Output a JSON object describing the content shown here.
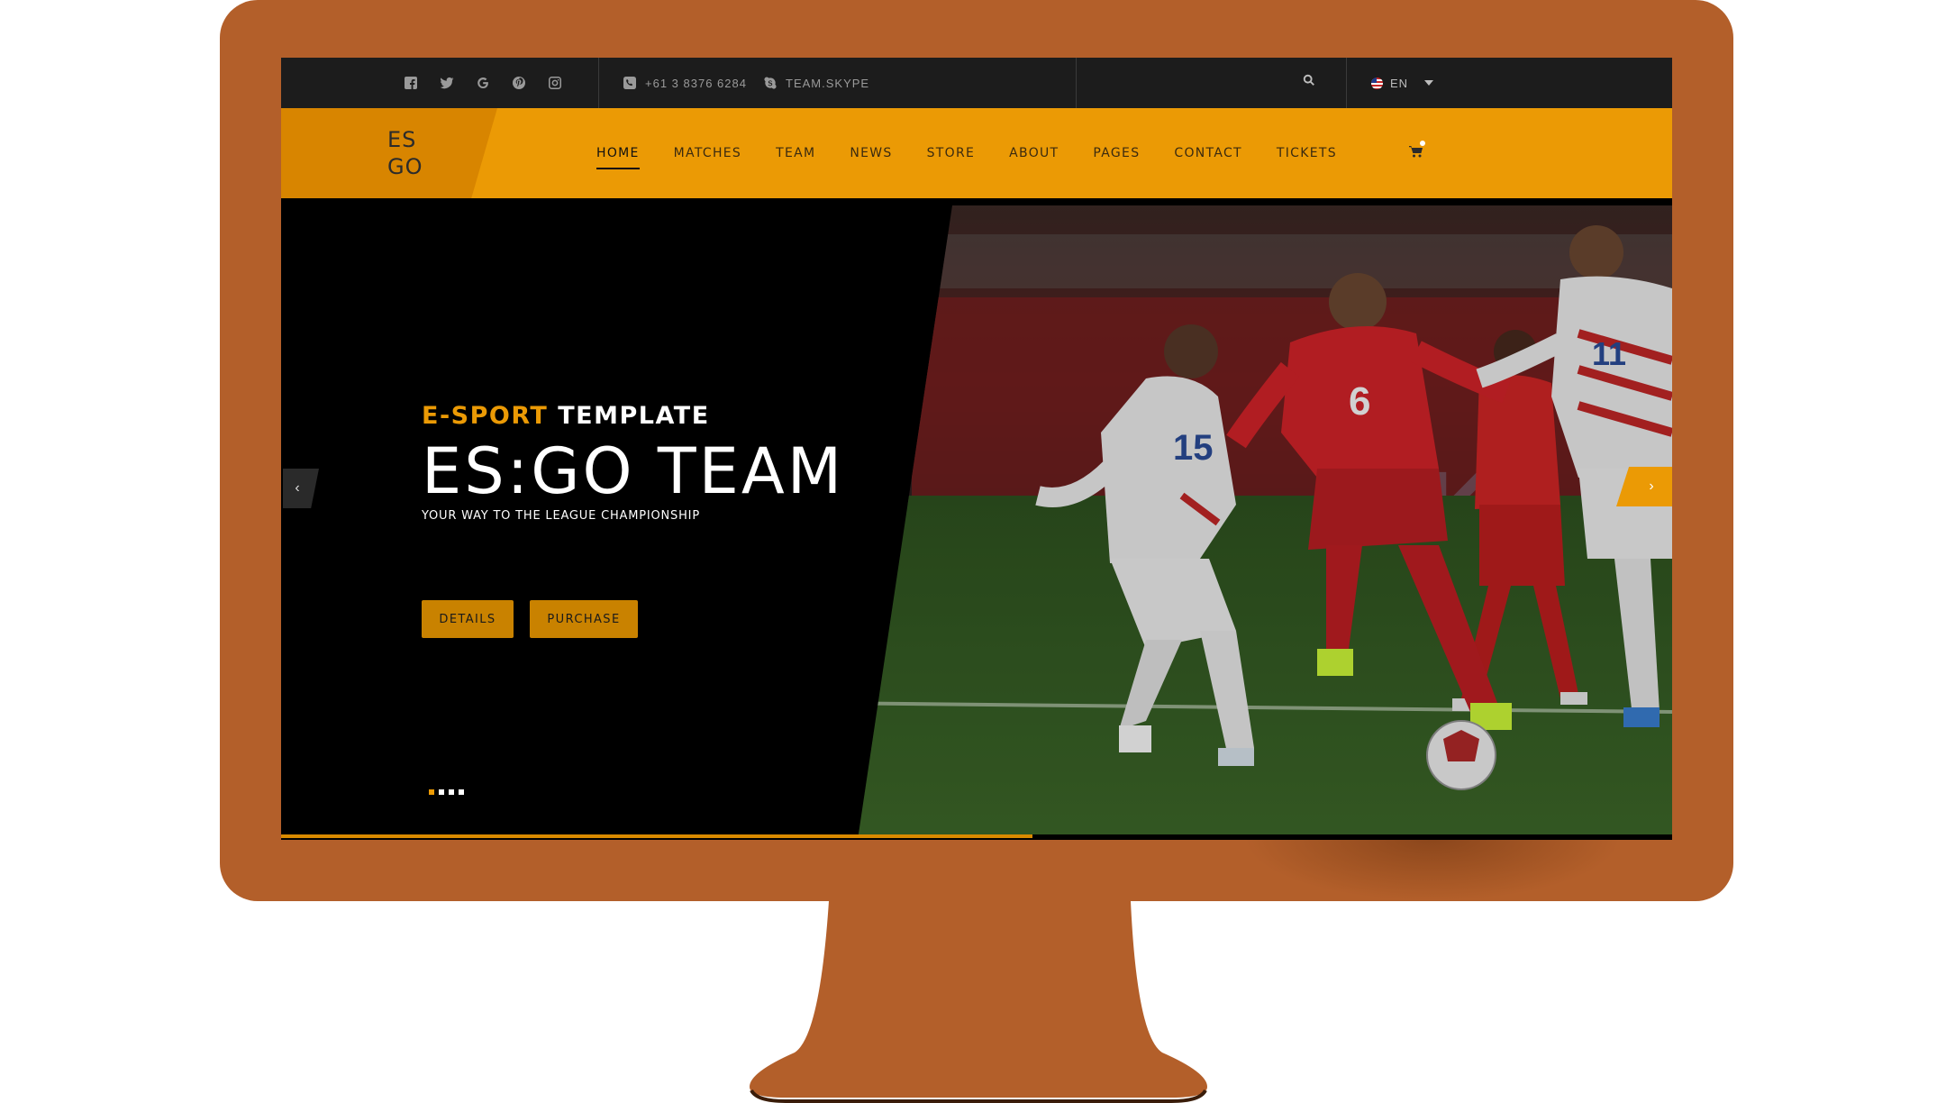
{
  "colors": {
    "accent": "#eb9a05",
    "monitor": "#b35f2a",
    "topbar": "#1c1c1c",
    "hero_bg": "#000000"
  },
  "topbar": {
    "socials": [
      "facebook-icon",
      "twitter-icon",
      "google-icon",
      "pinterest-icon",
      "instagram-icon"
    ],
    "phone": "+61 3 8376 6284",
    "skype": "TEAM.SKYPE",
    "language": "EN"
  },
  "nav": {
    "logo_line1": "ES",
    "logo_line2": "GO",
    "items": [
      {
        "label": "HOME",
        "active": true
      },
      {
        "label": "MATCHES"
      },
      {
        "label": "TEAM"
      },
      {
        "label": "NEWS"
      },
      {
        "label": "STORE"
      },
      {
        "label": "ABOUT"
      },
      {
        "label": "PAGES"
      },
      {
        "label": "CONTACT"
      },
      {
        "label": "TICKETS"
      }
    ]
  },
  "hero": {
    "eyebrow_highlight": "E-SPORT",
    "eyebrow_rest": "TEMPLATE",
    "headline": "ES:GO TEAM",
    "tagline": "YOUR WAY TO THE LEAGUE CHAMPIONSHIP",
    "details_label": "DETAILS",
    "purchase_label": "PURCHASE",
    "prev_arrow": "‹",
    "next_arrow": "›",
    "slide_count": 4,
    "active_slide": 1,
    "progress": 0.54
  },
  "photo_numbers": {
    "left_player": "15",
    "center_player": "6",
    "right_player": "11"
  }
}
